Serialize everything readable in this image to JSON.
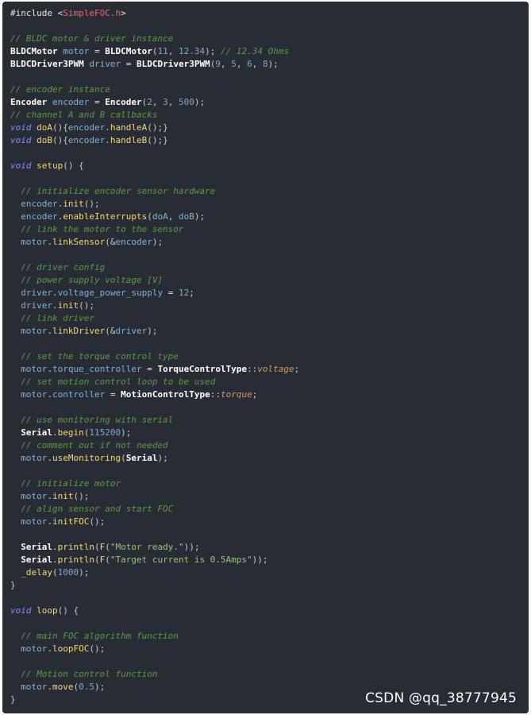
{
  "colors": {
    "background": "#282c34",
    "comment": "#5c9a45",
    "keyword": "#7c93ff",
    "string": "#98c379",
    "header": "#e06c75",
    "number": "#7fa9c8",
    "func": "#f0d878",
    "ident": "#7fb3d5",
    "type_bold": "#ffffff"
  },
  "watermark": "CSDN @qq_38777945",
  "code_lines": [
    [
      [
        "plain",
        "#include <"
      ],
      [
        "header",
        "SimpleFOC.h"
      ],
      [
        "plain",
        ">"
      ]
    ],
    [],
    [
      [
        "comment",
        "// BLDC motor & driver instance"
      ]
    ],
    [
      [
        "bold",
        "BLDCMotor"
      ],
      [
        "plain",
        " "
      ],
      [
        "ident",
        "motor"
      ],
      [
        "plain",
        " = "
      ],
      [
        "bold",
        "BLDCMotor"
      ],
      [
        "punct",
        "("
      ],
      [
        "number",
        "11"
      ],
      [
        "punct",
        ", "
      ],
      [
        "number",
        "12.34"
      ],
      [
        "punct",
        ");"
      ],
      [
        "plain",
        " "
      ],
      [
        "comment",
        "// 12.34 Ohms"
      ]
    ],
    [
      [
        "bold",
        "BLDCDriver3PWM"
      ],
      [
        "plain",
        " "
      ],
      [
        "ident",
        "driver"
      ],
      [
        "plain",
        " = "
      ],
      [
        "bold",
        "BLDCDriver3PWM"
      ],
      [
        "punct",
        "("
      ],
      [
        "number",
        "9"
      ],
      [
        "punct",
        ", "
      ],
      [
        "number",
        "5"
      ],
      [
        "punct",
        ", "
      ],
      [
        "number",
        "6"
      ],
      [
        "punct",
        ", "
      ],
      [
        "number",
        "8"
      ],
      [
        "punct",
        ");"
      ]
    ],
    [],
    [
      [
        "comment",
        "// encoder instance"
      ]
    ],
    [
      [
        "bold",
        "Encoder"
      ],
      [
        "plain",
        " "
      ],
      [
        "ident",
        "encoder"
      ],
      [
        "plain",
        " = "
      ],
      [
        "bold",
        "Encoder"
      ],
      [
        "punct",
        "("
      ],
      [
        "number",
        "2"
      ],
      [
        "punct",
        ", "
      ],
      [
        "number",
        "3"
      ],
      [
        "punct",
        ", "
      ],
      [
        "number",
        "500"
      ],
      [
        "punct",
        ");"
      ]
    ],
    [
      [
        "comment",
        "// channel A and B callbacks"
      ]
    ],
    [
      [
        "keyword",
        "void"
      ],
      [
        "plain",
        " "
      ],
      [
        "func",
        "doA"
      ],
      [
        "punct",
        "(){"
      ],
      [
        "ident",
        "encoder"
      ],
      [
        "punct",
        "."
      ],
      [
        "func",
        "handleA"
      ],
      [
        "punct",
        "();}"
      ]
    ],
    [
      [
        "keyword",
        "void"
      ],
      [
        "plain",
        " "
      ],
      [
        "func",
        "doB"
      ],
      [
        "punct",
        "(){"
      ],
      [
        "ident",
        "encoder"
      ],
      [
        "punct",
        "."
      ],
      [
        "func",
        "handleB"
      ],
      [
        "punct",
        "();}"
      ]
    ],
    [],
    [
      [
        "keyword",
        "void"
      ],
      [
        "plain",
        " "
      ],
      [
        "func",
        "setup"
      ],
      [
        "punct",
        "() {"
      ]
    ],
    [],
    [
      [
        "plain",
        "  "
      ],
      [
        "comment",
        "// initialize encoder sensor hardware"
      ]
    ],
    [
      [
        "plain",
        "  "
      ],
      [
        "ident",
        "encoder"
      ],
      [
        "punct",
        "."
      ],
      [
        "func",
        "init"
      ],
      [
        "punct",
        "();"
      ]
    ],
    [
      [
        "plain",
        "  "
      ],
      [
        "ident",
        "encoder"
      ],
      [
        "punct",
        "."
      ],
      [
        "func",
        "enableInterrupts"
      ],
      [
        "punct",
        "("
      ],
      [
        "ident",
        "doA"
      ],
      [
        "punct",
        ", "
      ],
      [
        "ident",
        "doB"
      ],
      [
        "punct",
        ");"
      ]
    ],
    [
      [
        "plain",
        "  "
      ],
      [
        "comment",
        "// link the motor to the sensor"
      ]
    ],
    [
      [
        "plain",
        "  "
      ],
      [
        "ident",
        "motor"
      ],
      [
        "punct",
        "."
      ],
      [
        "func",
        "linkSensor"
      ],
      [
        "punct",
        "(&"
      ],
      [
        "ident",
        "encoder"
      ],
      [
        "punct",
        ");"
      ]
    ],
    [],
    [
      [
        "plain",
        "  "
      ],
      [
        "comment",
        "// driver config"
      ]
    ],
    [
      [
        "plain",
        "  "
      ],
      [
        "comment",
        "// power supply voltage [V]"
      ]
    ],
    [
      [
        "plain",
        "  "
      ],
      [
        "ident",
        "driver"
      ],
      [
        "punct",
        "."
      ],
      [
        "ident",
        "voltage_power_supply"
      ],
      [
        "plain",
        " = "
      ],
      [
        "number",
        "12"
      ],
      [
        "punct",
        ";"
      ]
    ],
    [
      [
        "plain",
        "  "
      ],
      [
        "ident",
        "driver"
      ],
      [
        "punct",
        "."
      ],
      [
        "func",
        "init"
      ],
      [
        "punct",
        "();"
      ]
    ],
    [
      [
        "plain",
        "  "
      ],
      [
        "comment",
        "// link driver"
      ]
    ],
    [
      [
        "plain",
        "  "
      ],
      [
        "ident",
        "motor"
      ],
      [
        "punct",
        "."
      ],
      [
        "func",
        "linkDriver"
      ],
      [
        "punct",
        "(&"
      ],
      [
        "ident",
        "driver"
      ],
      [
        "punct",
        ");"
      ]
    ],
    [],
    [
      [
        "plain",
        "  "
      ],
      [
        "comment",
        "// set the torque control type"
      ]
    ],
    [
      [
        "plain",
        "  "
      ],
      [
        "ident",
        "motor"
      ],
      [
        "punct",
        "."
      ],
      [
        "ident",
        "torque_controller"
      ],
      [
        "plain",
        " = "
      ],
      [
        "bold",
        "TorqueControlType"
      ],
      [
        "punct",
        "::"
      ],
      [
        "enum",
        "voltage"
      ],
      [
        "punct",
        ";"
      ]
    ],
    [
      [
        "plain",
        "  "
      ],
      [
        "comment",
        "// set motion control loop to be used"
      ]
    ],
    [
      [
        "plain",
        "  "
      ],
      [
        "ident",
        "motor"
      ],
      [
        "punct",
        "."
      ],
      [
        "ident",
        "controller"
      ],
      [
        "plain",
        " = "
      ],
      [
        "bold",
        "MotionControlType"
      ],
      [
        "punct",
        "::"
      ],
      [
        "enum",
        "torque"
      ],
      [
        "punct",
        ";"
      ]
    ],
    [],
    [
      [
        "plain",
        "  "
      ],
      [
        "comment",
        "// use monitoring with serial"
      ]
    ],
    [
      [
        "plain",
        "  "
      ],
      [
        "bold",
        "Serial"
      ],
      [
        "punct",
        "."
      ],
      [
        "func",
        "begin"
      ],
      [
        "punct",
        "("
      ],
      [
        "number",
        "115200"
      ],
      [
        "punct",
        ");"
      ]
    ],
    [
      [
        "plain",
        "  "
      ],
      [
        "comment",
        "// comment out if not needed"
      ]
    ],
    [
      [
        "plain",
        "  "
      ],
      [
        "ident",
        "motor"
      ],
      [
        "punct",
        "."
      ],
      [
        "func",
        "useMonitoring"
      ],
      [
        "punct",
        "("
      ],
      [
        "bold",
        "Serial"
      ],
      [
        "punct",
        ");"
      ]
    ],
    [],
    [
      [
        "plain",
        "  "
      ],
      [
        "comment",
        "// initialize motor"
      ]
    ],
    [
      [
        "plain",
        "  "
      ],
      [
        "ident",
        "motor"
      ],
      [
        "punct",
        "."
      ],
      [
        "func",
        "init"
      ],
      [
        "punct",
        "();"
      ]
    ],
    [
      [
        "plain",
        "  "
      ],
      [
        "comment",
        "// align sensor and start FOC"
      ]
    ],
    [
      [
        "plain",
        "  "
      ],
      [
        "ident",
        "motor"
      ],
      [
        "punct",
        "."
      ],
      [
        "func",
        "initFOC"
      ],
      [
        "punct",
        "();"
      ]
    ],
    [],
    [
      [
        "plain",
        "  "
      ],
      [
        "bold",
        "Serial"
      ],
      [
        "punct",
        "."
      ],
      [
        "func",
        "println"
      ],
      [
        "punct",
        "("
      ],
      [
        "func",
        "F"
      ],
      [
        "punct",
        "("
      ],
      [
        "string",
        "\"Motor ready.\""
      ],
      [
        "punct",
        "));"
      ]
    ],
    [
      [
        "plain",
        "  "
      ],
      [
        "bold",
        "Serial"
      ],
      [
        "punct",
        "."
      ],
      [
        "func",
        "println"
      ],
      [
        "punct",
        "("
      ],
      [
        "func",
        "F"
      ],
      [
        "punct",
        "("
      ],
      [
        "string",
        "\"Target current is 0.5Amps\""
      ],
      [
        "punct",
        "));"
      ]
    ],
    [
      [
        "plain",
        "  "
      ],
      [
        "func",
        "_delay"
      ],
      [
        "punct",
        "("
      ],
      [
        "number",
        "1000"
      ],
      [
        "punct",
        ");"
      ]
    ],
    [
      [
        "punct",
        "}"
      ]
    ],
    [],
    [
      [
        "keyword",
        "void"
      ],
      [
        "plain",
        " "
      ],
      [
        "func",
        "loop"
      ],
      [
        "punct",
        "() {"
      ]
    ],
    [],
    [
      [
        "plain",
        "  "
      ],
      [
        "comment",
        "// main FOC algorithm function"
      ]
    ],
    [
      [
        "plain",
        "  "
      ],
      [
        "ident",
        "motor"
      ],
      [
        "punct",
        "."
      ],
      [
        "func",
        "loopFOC"
      ],
      [
        "punct",
        "();"
      ]
    ],
    [],
    [
      [
        "plain",
        "  "
      ],
      [
        "comment",
        "// Motion control function"
      ]
    ],
    [
      [
        "plain",
        "  "
      ],
      [
        "ident",
        "motor"
      ],
      [
        "punct",
        "."
      ],
      [
        "func",
        "move"
      ],
      [
        "punct",
        "("
      ],
      [
        "number",
        "0.5"
      ],
      [
        "punct",
        ");"
      ]
    ],
    [
      [
        "punct",
        "}"
      ]
    ]
  ]
}
